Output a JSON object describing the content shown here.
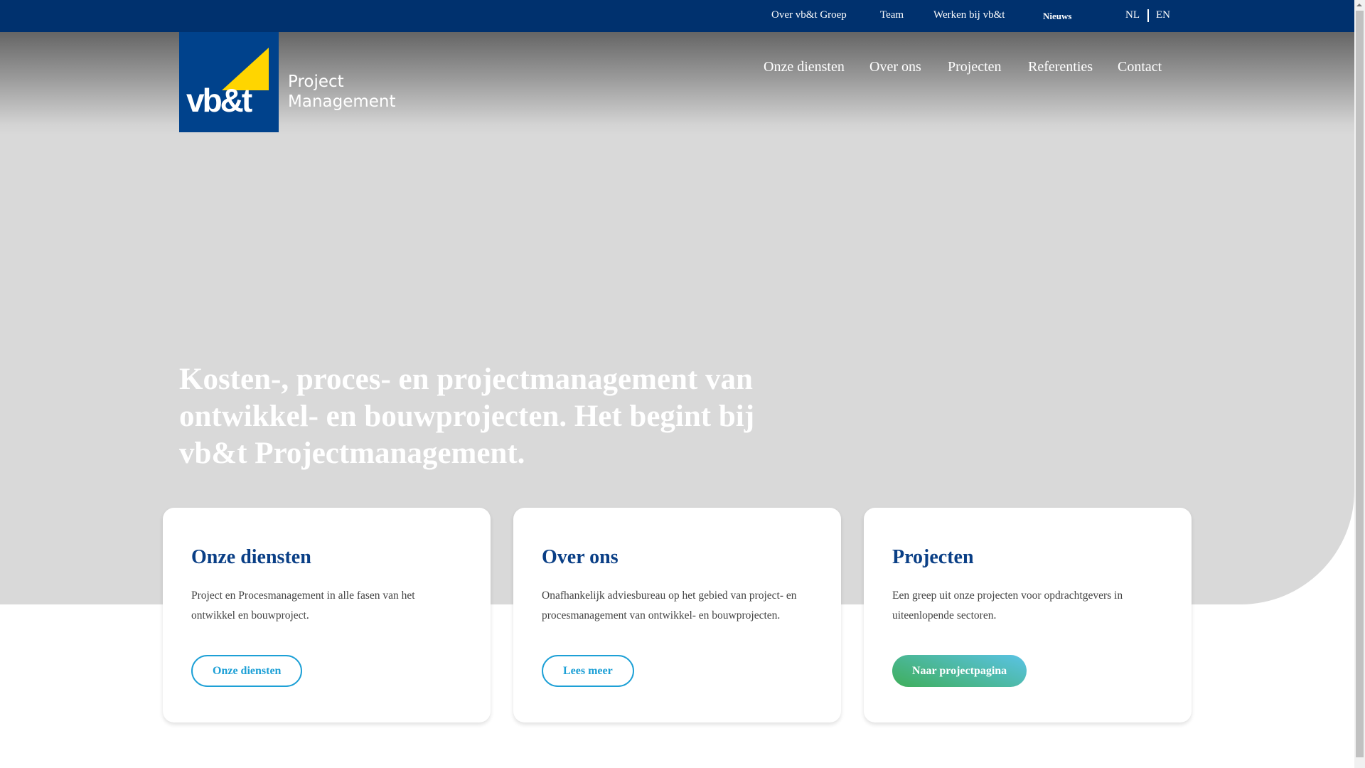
{
  "topbar": {
    "links": [
      "Over vb&t Groep",
      "Team",
      "Werken bij vb&t",
      "Nieuws"
    ],
    "lang": [
      "NL",
      "EN"
    ]
  },
  "logo": {
    "word": "vb&t",
    "line1": "Project",
    "line2": "Management"
  },
  "nav": [
    "Onze diensten",
    "Over ons",
    "Projecten",
    "Referenties",
    "Contact"
  ],
  "hero": {
    "text": "Kosten-, proces- en projectmanagement van ontwikkel- en bouwprojecten. Het begint bij vb&t Projectmanagement."
  },
  "cards": [
    {
      "title": "Onze diensten",
      "text": "Project en Procesmanagement in alle fasen van het ontwikkel en bouwproject.",
      "button": "Onze diensten"
    },
    {
      "title": "Over ons",
      "text": "Onafhankelijk adviesbureau op het gebied van project- en procesmanagement van ontwikkel- en bouwprojecten.",
      "button": "Lees meer"
    },
    {
      "title": "Projecten",
      "text": "Een greep uit onze projecten voor opdrachtgevers in uiteenlopende sectoren.",
      "button": "Naar projectpagina"
    }
  ],
  "colors": {
    "topbar": "#00316e",
    "brand_blue": "#0a3f86",
    "accent": "#1da0d6",
    "logo_yellow": "#ffd500"
  }
}
